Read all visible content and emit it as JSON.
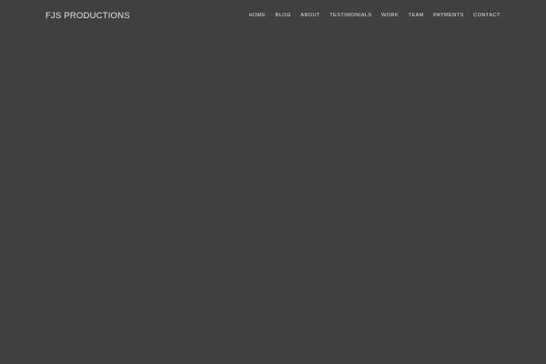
{
  "site": {
    "brand": "FJS PRODUCTIONS"
  },
  "nav": {
    "separator": "·",
    "items": [
      {
        "id": "home",
        "label": "HOME"
      },
      {
        "id": "blog",
        "label": "BLOG"
      },
      {
        "id": "about",
        "label": "ABOUT"
      },
      {
        "id": "testimonials",
        "label": "TESTIMONIALS"
      },
      {
        "id": "work",
        "label": "WORK"
      },
      {
        "id": "team",
        "label": "TEAM"
      },
      {
        "id": "payments",
        "label": "PAYMENTS"
      },
      {
        "id": "contact",
        "label": "CONTACT"
      }
    ]
  },
  "colors": {
    "background": "#404040",
    "text": "#e2e2e2",
    "separator": "#9a9a9a"
  }
}
